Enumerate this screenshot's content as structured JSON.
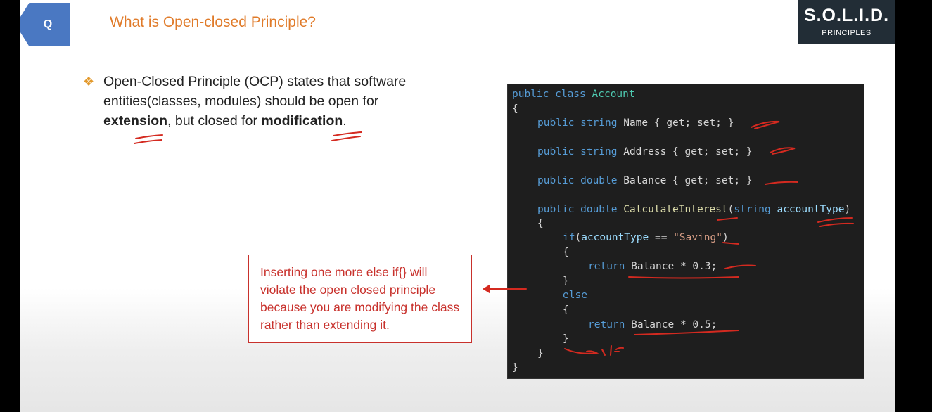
{
  "header": {
    "badge": "Q",
    "title": "What is Open-closed Principle?",
    "logo_main": "S.O.L.I.D.",
    "logo_sub": "PRINCIPLES"
  },
  "bullet": {
    "part1": "Open-Closed Principle (OCP) states that software entities(classes, modules) should be open for ",
    "bold1": "extension",
    "part2": ", but closed for ",
    "bold2": "modification",
    "part3": "."
  },
  "note": {
    "text": "Inserting one more else if{} will violate the open closed principle because you are modifying the class rather than extending it."
  },
  "code": {
    "l1_kw": "public class ",
    "l1_ty": "Account",
    "l2": "{",
    "l3_kw": "public string ",
    "l3_id": "Name",
    "l3_rest": " { get; set; }",
    "l4_kw": "public string ",
    "l4_id": "Address",
    "l4_rest": " { get; set; }",
    "l5_kw": "public double ",
    "l5_id": "Balance",
    "l5_rest": " { get; set; }",
    "l6_kw": "public double ",
    "l6_fn": "CalculateInterest",
    "l6_a": "(",
    "l6_kw2": "string ",
    "l6_pm": "accountType",
    "l6_b": ")",
    "l7": "{",
    "l8_kw": "if",
    "l8_a": "(",
    "l8_pm": "accountType",
    "l8_b": " == ",
    "l8_str": "\"Saving\"",
    "l8_c": ")",
    "l9": "{",
    "l10_kw": "return ",
    "l10_rest": "Balance * 0.3;",
    "l11": "}",
    "l12_kw": "else",
    "l13": "{",
    "l14_kw": "return ",
    "l14_rest": "Balance * 0.5;",
    "l15": "}",
    "l16": "}",
    "l17": "}"
  },
  "colors": {
    "accent": "#e07b2a",
    "badge": "#4a78c2",
    "annotation_red": "#d42a20"
  }
}
